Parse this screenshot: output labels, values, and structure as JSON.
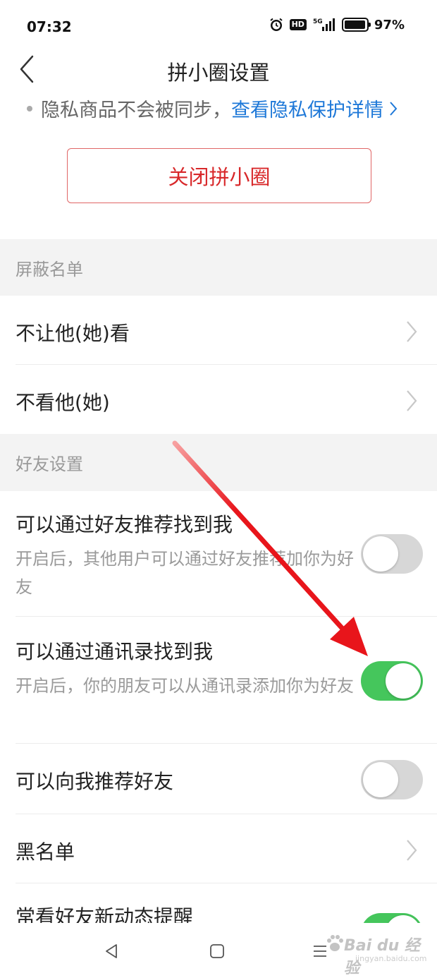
{
  "status_bar": {
    "time": "07:32",
    "hd": "HD",
    "network": "5G",
    "battery": "97%",
    "battery_level": 0.97
  },
  "header": {
    "title": "拼小圈设置"
  },
  "privacy_note": {
    "text": "隐私商品不会被同步，",
    "link": "查看隐私保护详情"
  },
  "close_button": {
    "label": "关闭拼小圈"
  },
  "sections": {
    "block_list": {
      "title": "屏蔽名单",
      "items": [
        {
          "label": "不让他(她)看"
        },
        {
          "label": "不看他(她)"
        }
      ]
    },
    "friend_settings": {
      "title": "好友设置",
      "items": [
        {
          "label": "可以通过好友推荐找到我",
          "desc": "开启后，其他用户可以通过好友推荐加你为好友",
          "enabled": false
        },
        {
          "label": "可以通过通讯录找到我",
          "desc": "开启后，你的朋友可以从通讯录添加你为好友",
          "enabled": true
        },
        {
          "label": "可以向我推荐好友",
          "enabled": false
        },
        {
          "label": "黑名单"
        },
        {
          "label": "常看好友新动态提醒",
          "enabled": true
        }
      ]
    }
  },
  "watermark": {
    "text": "Bai du 经验",
    "url": "jingyan.baidu.com"
  },
  "colors": {
    "accent_red": "#d8282a",
    "link_blue": "#1e78d8",
    "toggle_on": "#45c65c",
    "toggle_off": "#d7d7d7",
    "arrow_red": "#e8151b"
  }
}
